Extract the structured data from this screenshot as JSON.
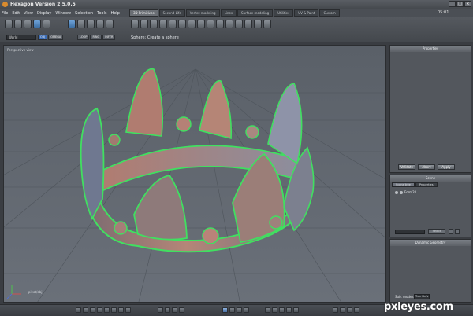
{
  "window": {
    "title": "Hexagon Version 2.5.0.5",
    "clock": "05:01",
    "buttons": [
      "_",
      "□",
      "x"
    ]
  },
  "menu": [
    "File",
    "Edit",
    "View",
    "Display",
    "Window",
    "Selection",
    "Tools",
    "Help"
  ],
  "tabs": [
    "3D Primitives",
    "Second Life",
    "Vertex modeling",
    "Lines",
    "Surface modeling",
    "Utilities",
    "UV & Paint",
    "Custom"
  ],
  "toolbar": {
    "coord_select": "World",
    "mode_buttons": [
      "OBJ",
      "OMEGA"
    ],
    "snap_buttons": [
      "LOOP",
      "RING",
      "INFTR"
    ],
    "hint": "Sphere: Create a sphere"
  },
  "viewport": {
    "label": "Perspective view",
    "axis_label": "pivot/obj"
  },
  "properties": {
    "title": "Properties",
    "buttons": [
      "Validate",
      "Abort",
      "Apply"
    ]
  },
  "scene": {
    "title": "Scene",
    "tabs": [
      "Scene tree",
      "Properties"
    ],
    "item": "Form20",
    "select_label": "Select"
  },
  "dynamic_geometry": {
    "title": "Dynamic Geometry",
    "sub_label": "Sub. modes",
    "select_value": "Tree Defs"
  },
  "watermark": "pxleyes.com",
  "colors": {
    "accent": "#3b6cb5",
    "wire_green": "#40e060",
    "crown_base": "#8a7064"
  }
}
